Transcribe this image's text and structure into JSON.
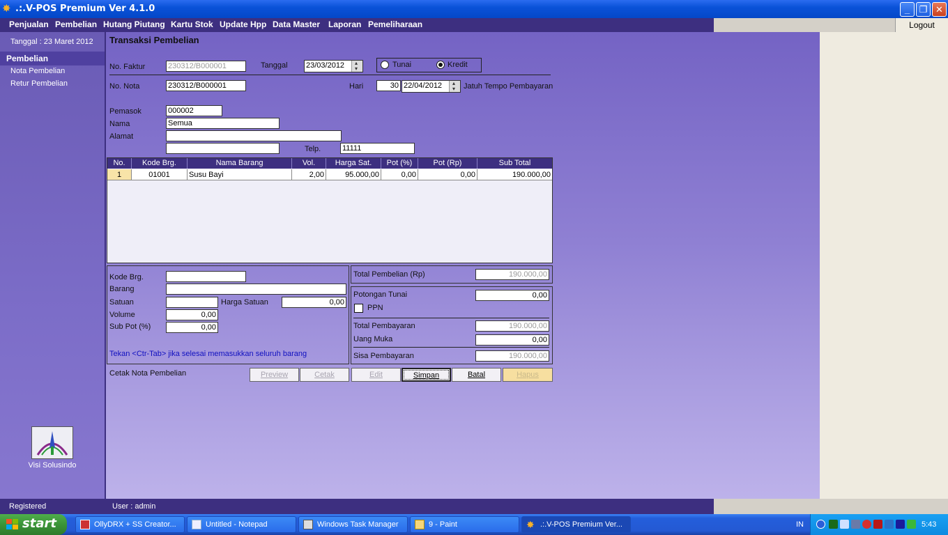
{
  "window": {
    "title": ".:.V-POS Premium Ver 4.1.0"
  },
  "menu": [
    "Penjualan",
    "Pembelian",
    "Hutang Piutang",
    "Kartu Stok",
    "Update Hpp",
    "Data Master",
    "Laporan",
    "Pemeliharaan"
  ],
  "logout_label": "Logout",
  "sidebar": {
    "date_text": "Tanggal : 23 Maret 2012",
    "section": "Pembelian",
    "items": [
      "Nota Pembelian",
      "Retur Pembelian"
    ],
    "logo_label": "Visi Solusindo"
  },
  "form": {
    "title": "Transaksi Pembelian",
    "no_faktur_label": "No. Faktur",
    "no_faktur_value": "230312/B000001",
    "tanggal_label": "Tanggal",
    "tanggal_value": "23/03/2012",
    "payment_options": [
      "Tunai",
      "Kredit"
    ],
    "payment_selected": "Kredit",
    "no_nota_label": "No. Nota",
    "no_nota_value": "230312/B000001",
    "hari_label": "Hari",
    "hari_value": "30",
    "jatuh_tempo_value": "22/04/2012",
    "jatuh_tempo_label": "Jatuh Tempo Pembayaran",
    "pemasok_label": "Pemasok",
    "pemasok_value": "000002",
    "nama_label": "Nama",
    "nama_value": "Semua",
    "alamat_label": "Alamat",
    "alamat_value": "",
    "alamat2_value": "",
    "telp_label": "Telp.",
    "telp_value": "11111"
  },
  "grid": {
    "headers": [
      "No.",
      "Kode Brg.",
      "Nama Barang",
      "Vol.",
      "Harga Sat.",
      "Pot (%)",
      "Pot (Rp)",
      "Sub Total"
    ],
    "rows": [
      [
        "1",
        "01001",
        "Susu Bayi",
        "2,00",
        "95.000,00",
        "0,00",
        "0,00",
        "190.000,00"
      ]
    ]
  },
  "entry": {
    "kode_label": "Kode Brg.",
    "kode_value": "",
    "barang_label": "Barang",
    "barang_value": "",
    "satuan_label": "Satuan",
    "satuan_value": "",
    "harga_satuan_label": "Harga Satuan",
    "harga_satuan_value": "0,00",
    "volume_label": "Volume",
    "volume_value": "0,00",
    "subpot_label": "Sub Pot (%)",
    "subpot_value": "0,00",
    "hint": "Tekan <Ctr-Tab> jika selesai memasukkan seluruh barang"
  },
  "totals": {
    "total_pembelian_label": "Total Pembelian (Rp)",
    "total_pembelian_value": "190.000,00",
    "potongan_tunai_label": "Potongan Tunai",
    "potongan_tunai_value": "0,00",
    "ppn_label": "PPN",
    "total_pembayaran_label": "Total Pembayaran",
    "total_pembayaran_value": "190.000,00",
    "uang_muka_label": "Uang Muka",
    "uang_muka_value": "0,00",
    "sisa_label": "Sisa Pembayaran",
    "sisa_value": "190.000,00"
  },
  "actions": {
    "cetak_label": "Cetak Nota Pembelian",
    "preview": "Preview",
    "cetak": "Cetak",
    "edit": "Edit",
    "simpan": "Simpan",
    "batal": "Batal",
    "hapus": "Hapus"
  },
  "status": {
    "left": "Registered",
    "user": "User : admin"
  },
  "taskbar": {
    "start": "start",
    "tasks": [
      "OllyDRX + SS Creator...",
      "Untitled - Notepad",
      "Windows Task Manager",
      "9 - Paint",
      ".:.V-POS Premium Ver..."
    ],
    "lang": "IN",
    "clock": "5:43"
  },
  "colors": {
    "menubar": "#3d2f80",
    "taskbar": "#245edb",
    "accent_button": "#f7dfa0"
  }
}
